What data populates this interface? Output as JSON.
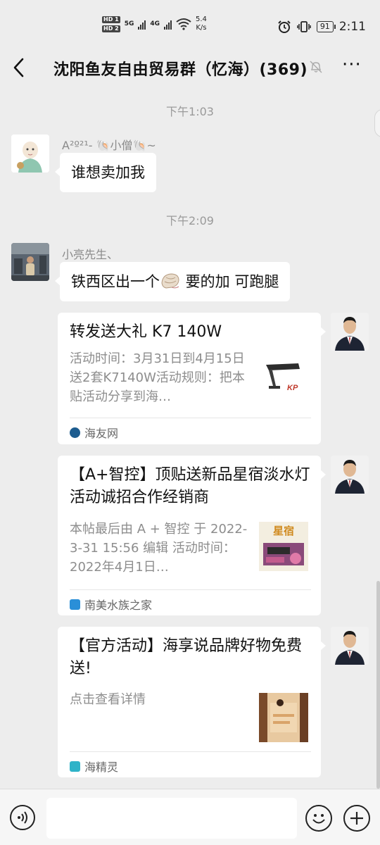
{
  "status_bar": {
    "hd1": "HD 1",
    "hd2": "HD 2",
    "net1": "5G",
    "net2": "4G",
    "speed_value": "5.4",
    "speed_unit": "K/s",
    "battery": "91",
    "time": "2:11"
  },
  "header": {
    "title": "沈阳鱼友自由贸易群（忆海）(369)",
    "back_icon": "chevron-left-icon",
    "mute_icon": "bell-off-icon",
    "more_label": "···"
  },
  "messages": [
    {
      "type": "timestamp",
      "text": "下午1:03"
    },
    {
      "type": "text",
      "sender": "A²º²¹- 🐚小僧🐚~",
      "text": "谁想卖加我"
    },
    {
      "type": "timestamp",
      "text": "下午2:09"
    },
    {
      "type": "text",
      "sender": "小亮先生、",
      "text_before": "铁西区出一个",
      "text_icon": "conch-shell-icon",
      "text_after": " 要的加 可跑腿"
    },
    {
      "type": "link_card",
      "title": "转发送大礼 K7 140W",
      "desc": "活动时间：3月31日到4月15日送2套K7140W活动规则：把本贴活动分享到海…",
      "thumb_label": "KP",
      "source": "海友网",
      "source_color": "#1d5c8f"
    },
    {
      "type": "link_card",
      "title": "【A+智控】顶贴送新品星宿淡水灯活动诚招合作经销商",
      "desc": " 本帖最后由 A + 智控 于 2022-3-31 15:56 编辑 活动时间：2022年4月1日…",
      "thumb_label": "星宿",
      "source": "南美水族之家",
      "source_color": "#2a8fd8"
    },
    {
      "type": "link_card",
      "title": "【官方活动】海享说品牌好物免费送!",
      "desc": "点击查看详情",
      "thumb_label": "",
      "source": "海精灵",
      "source_color": "#2fb3c8"
    }
  ],
  "input_bar": {
    "voice_icon": "voice-icon",
    "emoji_icon": "emoji-icon",
    "plus_icon": "plus-icon",
    "input_value": ""
  }
}
